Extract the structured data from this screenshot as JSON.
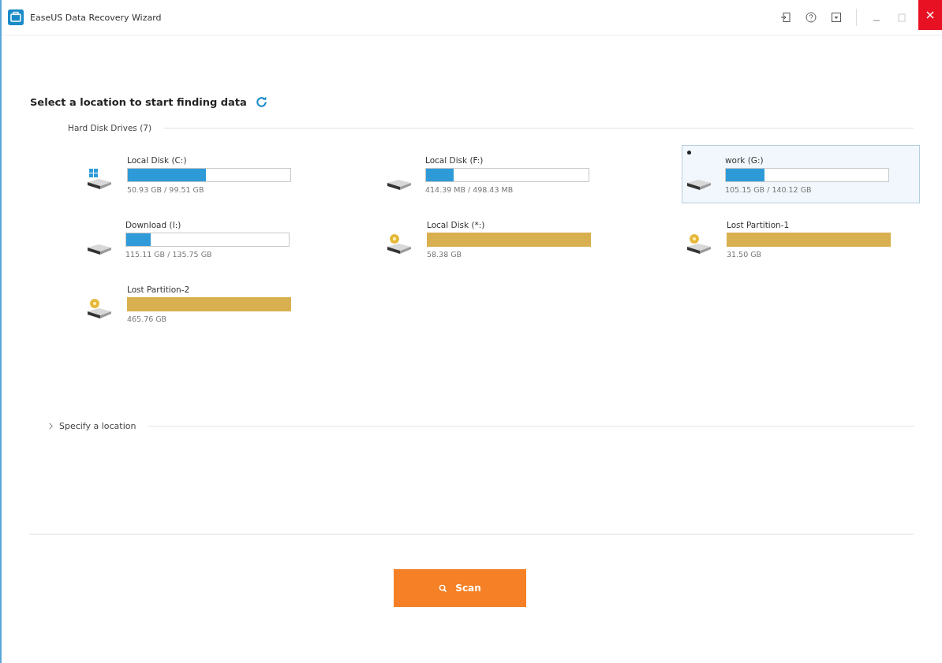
{
  "window": {
    "title": "EaseUS Data Recovery Wizard"
  },
  "heading": "Select a location to start finding data",
  "drives_section": {
    "title": "Hard Disk Drives (7)",
    "drives": [
      {
        "kind": "system",
        "name": "Local Disk (C:)",
        "level": 0.48,
        "size": "50.93 GB / 99.51 GB",
        "selected": false
      },
      {
        "kind": "normal",
        "name": "Local Disk (F:)",
        "level": 0.17,
        "size": "414.39 MB / 498.43 MB",
        "selected": false
      },
      {
        "kind": "normal",
        "name": "work (G:)",
        "level": 0.24,
        "size": "105.15 GB / 140.12 GB",
        "selected": true
      },
      {
        "kind": "normal",
        "name": "Download (I:)",
        "level": 0.15,
        "size": "115.11 GB / 135.75 GB",
        "selected": false
      },
      {
        "kind": "lost",
        "name": "Local Disk (*:)",
        "level": 1,
        "size": "58.38 GB",
        "selected": false
      },
      {
        "kind": "lost",
        "name": "Lost Partition-1",
        "level": 1,
        "size": "31.50 GB",
        "selected": false
      },
      {
        "kind": "lost",
        "name": "Lost Partition-2",
        "level": 1,
        "size": "465.76 GB",
        "selected": false
      }
    ]
  },
  "specify": {
    "label": "Specify a location",
    "expanded": false
  },
  "scan_button": "Scan"
}
